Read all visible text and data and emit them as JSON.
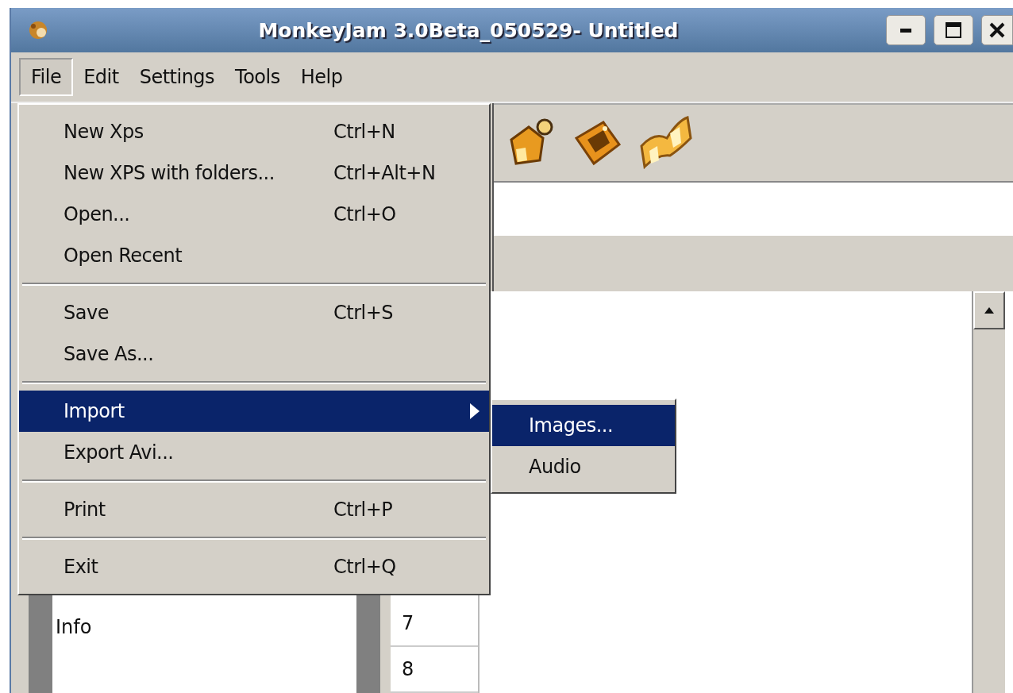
{
  "window": {
    "title": "MonkeyJam 3.0Beta_050529- Untitled"
  },
  "menubar": [
    {
      "label": "File",
      "selected": true
    },
    {
      "label": "Edit",
      "selected": false
    },
    {
      "label": "Settings",
      "selected": false
    },
    {
      "label": "Tools",
      "selected": false
    },
    {
      "label": "Help",
      "selected": false
    }
  ],
  "toolbar": {
    "buttons": [
      {
        "kind": "pin"
      },
      {
        "kind": "box"
      },
      {
        "kind": "wave"
      }
    ]
  },
  "file_menu": {
    "items": [
      {
        "kind": "item",
        "label": "New Xps",
        "shortcut": "Ctrl+N",
        "selected": false,
        "has_submenu": false
      },
      {
        "kind": "item",
        "label": "New XPS with folders...",
        "shortcut": "Ctrl+Alt+N",
        "selected": false,
        "has_submenu": false
      },
      {
        "kind": "item",
        "label": "Open...",
        "shortcut": "Ctrl+O",
        "selected": false,
        "has_submenu": false
      },
      {
        "kind": "item",
        "label": "Open Recent",
        "selected": false,
        "has_submenu": false
      },
      {
        "kind": "separator"
      },
      {
        "kind": "item",
        "label": "Save",
        "shortcut": "Ctrl+S",
        "selected": false,
        "has_submenu": false
      },
      {
        "kind": "item",
        "label": "Save As...",
        "selected": false,
        "has_submenu": false
      },
      {
        "kind": "separator"
      },
      {
        "kind": "item",
        "label": "Import",
        "selected": true,
        "has_submenu": true
      },
      {
        "kind": "item",
        "label": "Export Avi...",
        "selected": false,
        "has_submenu": false
      },
      {
        "kind": "separator"
      },
      {
        "kind": "item",
        "label": "Print",
        "shortcut": "Ctrl+P",
        "selected": false,
        "has_submenu": false
      },
      {
        "kind": "separator"
      },
      {
        "kind": "item",
        "label": "Exit",
        "shortcut": "Ctrl+Q",
        "selected": false,
        "has_submenu": false
      }
    ]
  },
  "import_submenu": {
    "items": [
      {
        "label": "Images...",
        "selected": true
      },
      {
        "label": "Audio",
        "selected": false
      }
    ]
  },
  "side_panel": {
    "items": [
      "Info"
    ]
  },
  "frame_list": {
    "rows": [
      "7",
      "8"
    ]
  }
}
